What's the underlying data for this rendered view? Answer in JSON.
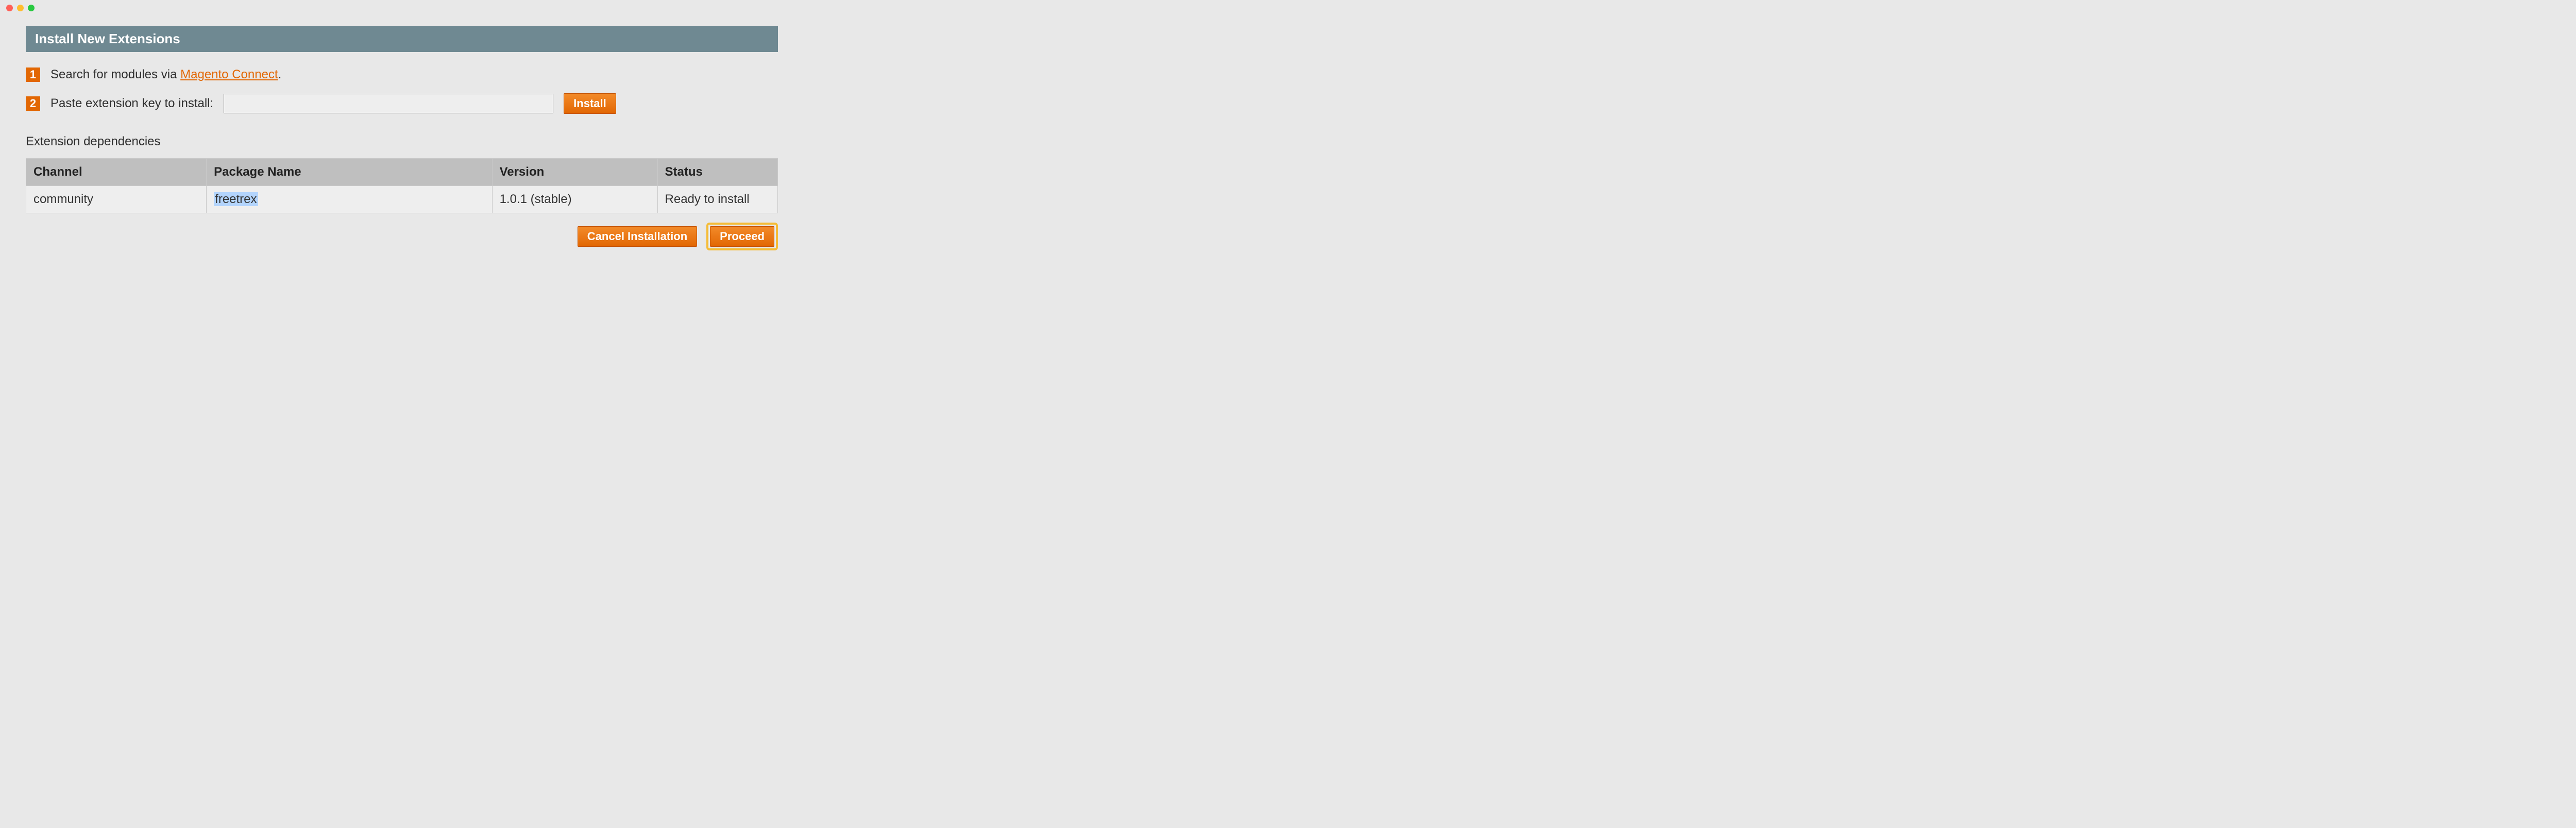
{
  "header": {
    "title": "Install New Extensions"
  },
  "steps": {
    "one": {
      "num": "1",
      "prefix": "Search for modules via ",
      "link": "Magento Connect",
      "suffix": "."
    },
    "two": {
      "num": "2",
      "label": "Paste extension key to install:",
      "install_btn": "Install",
      "input_value": ""
    }
  },
  "dependencies": {
    "heading": "Extension dependencies",
    "columns": {
      "channel": "Channel",
      "package": "Package Name",
      "version": "Version",
      "status": "Status"
    },
    "rows": [
      {
        "channel": "community",
        "package": "freetrex",
        "version": "1.0.1 (stable)",
        "status": "Ready to install"
      }
    ]
  },
  "actions": {
    "cancel": "Cancel Installation",
    "proceed": "Proceed"
  }
}
